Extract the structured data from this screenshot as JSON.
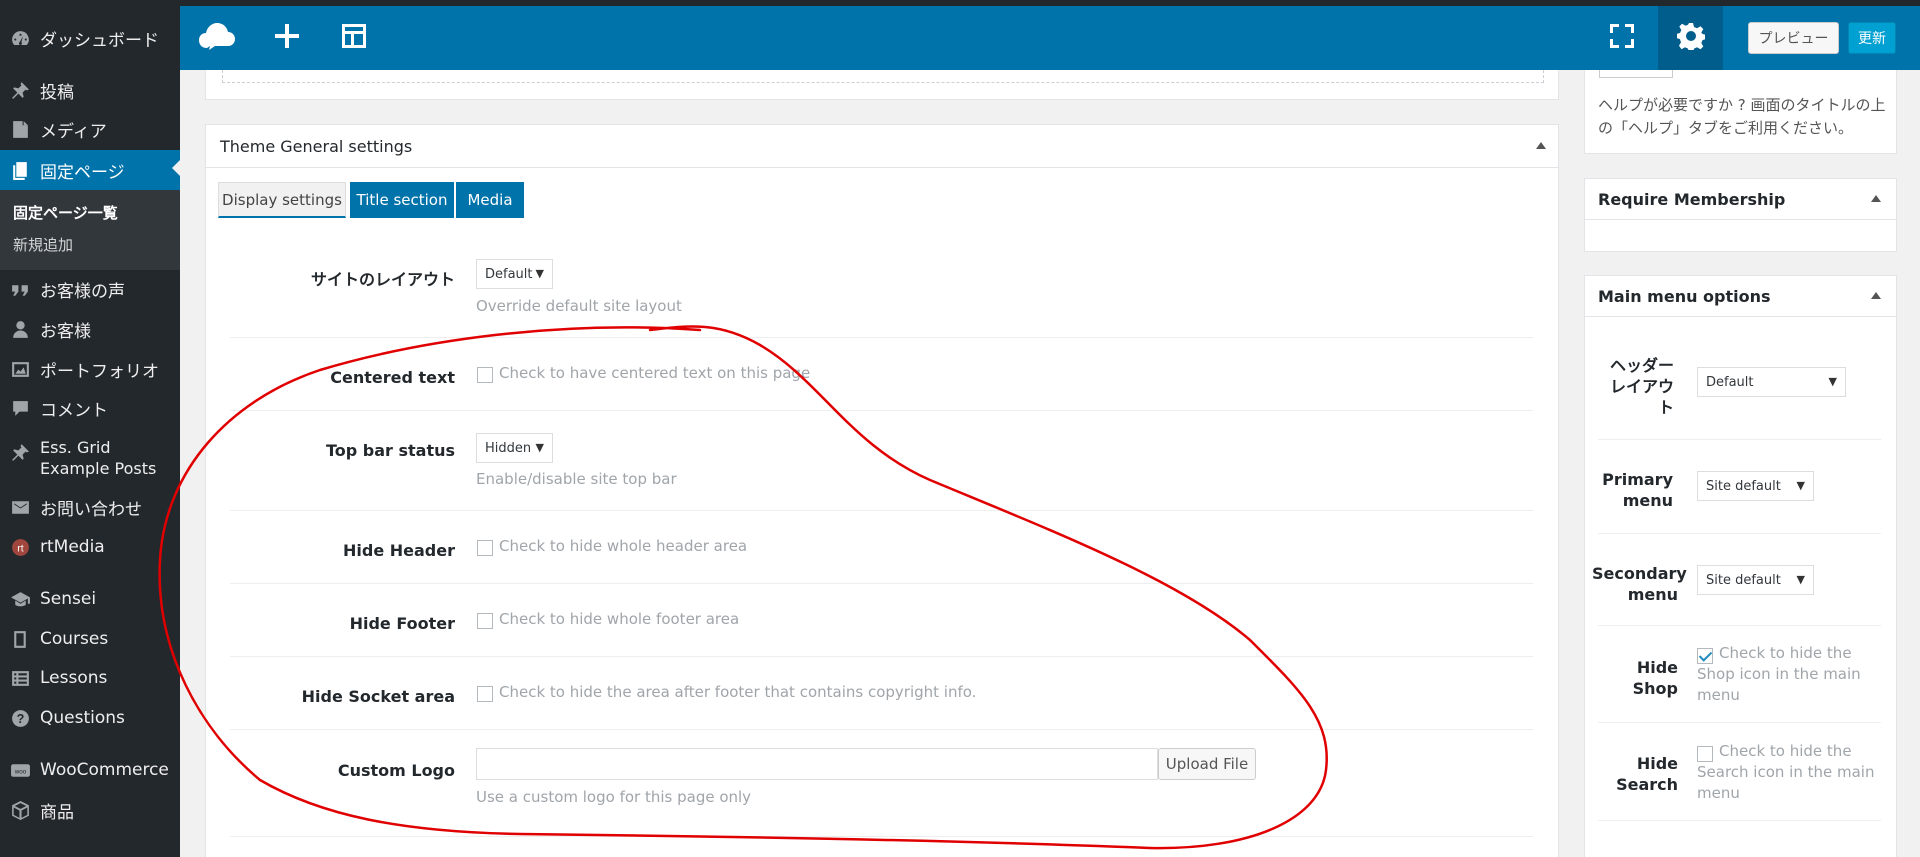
{
  "sidebar": {
    "items": [
      {
        "label": "ダッシュボード",
        "icon": "dashboard-icon"
      },
      {
        "label": "投稿",
        "icon": "pin-icon"
      },
      {
        "label": "メディア",
        "icon": "media-icon"
      },
      {
        "label": "固定ページ",
        "icon": "pages-icon"
      },
      {
        "label": "お客様の声",
        "icon": "quote-icon"
      },
      {
        "label": "お客様",
        "icon": "person-icon"
      },
      {
        "label": "ポートフォリオ",
        "icon": "portfolio-icon"
      },
      {
        "label": "コメント",
        "icon": "comment-icon"
      },
      {
        "label": "Ess. Grid Example Posts",
        "icon": "pin-icon"
      },
      {
        "label": "お問い合わせ",
        "icon": "mail-icon"
      },
      {
        "label": "rtMedia",
        "icon": "rtmedia-icon"
      },
      {
        "label": "Sensei",
        "icon": "graduation-cap-icon"
      },
      {
        "label": "Courses",
        "icon": "book-icon"
      },
      {
        "label": "Lessons",
        "icon": "list-icon"
      },
      {
        "label": "Questions",
        "icon": "question-icon"
      },
      {
        "label": "WooCommerce",
        "icon": "woocommerce-icon"
      },
      {
        "label": "商品",
        "icon": "box-icon"
      }
    ],
    "submenu": {
      "all_pages": "固定ページ一覧",
      "add_new": "新規追加"
    }
  },
  "toolbar": {
    "preview_label": "プレビュー",
    "update_label": "更新"
  },
  "main": {
    "panel_title": "Theme General settings",
    "tabs": [
      "Display settings",
      "Title section",
      "Media"
    ],
    "fields": {
      "site_layout": {
        "label": "サイトのレイアウト",
        "value": "Default",
        "hint": "Override default site layout"
      },
      "centered_text": {
        "label": "Centered text",
        "hint": "Check to have centered text on this page"
      },
      "top_bar_status": {
        "label": "Top bar status",
        "value": "Hidden",
        "hint": "Enable/disable site top bar"
      },
      "hide_header": {
        "label": "Hide Header",
        "hint": "Check to hide whole header area"
      },
      "hide_footer": {
        "label": "Hide Footer",
        "hint": "Check to hide whole footer area"
      },
      "hide_socket": {
        "label": "Hide Socket area",
        "hint": "Check to hide the area after footer that contains copyright info."
      },
      "custom_logo": {
        "label": "Custom Logo",
        "button": "Upload File",
        "hint": "Use a custom logo for this page only"
      }
    }
  },
  "right": {
    "help_text": "ヘルプが必要ですか ? 画面のタイトルの上の「ヘルプ」タブをご利用ください。",
    "membership_title": "Require Membership",
    "menu_options": {
      "title": "Main menu options",
      "header_layout": {
        "label": "ヘッダーレイアウト",
        "value": "Default"
      },
      "primary_menu": {
        "label": "Primary menu",
        "value": "Site default"
      },
      "secondary_menu": {
        "label": "Secondary menu",
        "value": "Site default"
      },
      "hide_shop": {
        "label": "Hide Shop",
        "hint": "Check to hide the Shop icon in the main menu",
        "checked": true
      },
      "hide_search": {
        "label": "Hide Search",
        "hint": "Check to hide the Search icon in the main menu",
        "checked": false
      }
    }
  },
  "colors": {
    "admin_sidebar": "#23282d",
    "accent_blue": "#0073aa",
    "update_blue": "#00a0d2",
    "annotation_red": "#e00000"
  }
}
